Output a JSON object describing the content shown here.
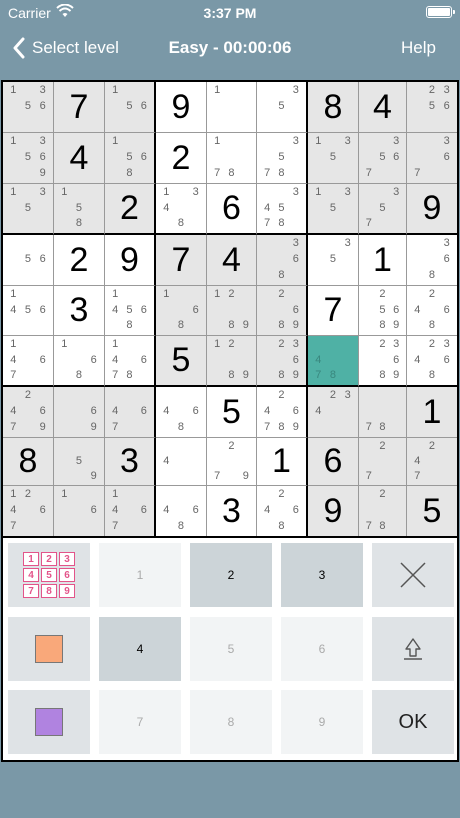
{
  "status": {
    "carrier": "Carrier",
    "time": "3:37 PM"
  },
  "nav": {
    "back": "Select level",
    "title": "Easy - 00:00:06",
    "help": "Help"
  },
  "board": {
    "selected": [
      5,
      6
    ],
    "rows": [
      [
        {
          "n": [
            1,
            3,
            5,
            6
          ]
        },
        {
          "v": "7"
        },
        {
          "n": [
            1,
            5,
            6
          ]
        },
        {
          "v": "9"
        },
        {
          "n": [
            1
          ]
        },
        {
          "n": [
            3,
            5
          ]
        },
        {
          "v": "8"
        },
        {
          "v": "4"
        },
        {
          "n": [
            2,
            3,
            5,
            6
          ]
        }
      ],
      [
        {
          "n": [
            1,
            3,
            5,
            6,
            9
          ]
        },
        {
          "v": "4"
        },
        {
          "n": [
            1,
            5,
            6,
            8
          ]
        },
        {
          "v": "2"
        },
        {
          "n": [
            1,
            7,
            8
          ]
        },
        {
          "n": [
            3,
            5,
            7,
            8
          ]
        },
        {
          "n": [
            1,
            3,
            5
          ]
        },
        {
          "n": [
            3,
            5,
            6,
            7
          ]
        },
        {
          "n": [
            3,
            6,
            7
          ]
        }
      ],
      [
        {
          "n": [
            1,
            3,
            5
          ]
        },
        {
          "n": [
            1,
            5,
            8
          ]
        },
        {
          "v": "2"
        },
        {
          "n": [
            1,
            3,
            4,
            8
          ]
        },
        {
          "v": "6"
        },
        {
          "n": [
            3,
            4,
            5,
            7,
            8
          ]
        },
        {
          "n": [
            1,
            3,
            5
          ]
        },
        {
          "n": [
            3,
            5,
            7
          ]
        },
        {
          "v": "9"
        }
      ],
      [
        {
          "n": [
            5,
            6
          ]
        },
        {
          "v": "2"
        },
        {
          "v": "9"
        },
        {
          "v": "7"
        },
        {
          "v": "4"
        },
        {
          "n": [
            3,
            6,
            8
          ]
        },
        {
          "n": [
            3,
            5
          ]
        },
        {
          "v": "1"
        },
        {
          "n": [
            3,
            6,
            8
          ]
        }
      ],
      [
        {
          "n": [
            1,
            4,
            5,
            6
          ]
        },
        {
          "v": "3"
        },
        {
          "n": [
            1,
            4,
            5,
            6,
            8
          ]
        },
        {
          "n": [
            1,
            6,
            8
          ]
        },
        {
          "n": [
            1,
            2,
            8,
            9
          ]
        },
        {
          "n": [
            2,
            6,
            8,
            9
          ]
        },
        {
          "v": "7"
        },
        {
          "n": [
            2,
            5,
            6,
            8,
            9
          ]
        },
        {
          "n": [
            2,
            4,
            6,
            8
          ]
        }
      ],
      [
        {
          "n": [
            1,
            4,
            6,
            7
          ]
        },
        {
          "n": [
            1,
            6,
            8
          ]
        },
        {
          "n": [
            1,
            4,
            6,
            7,
            8
          ]
        },
        {
          "v": "5"
        },
        {
          "n": [
            1,
            2,
            8,
            9
          ]
        },
        {
          "n": [
            2,
            3,
            6,
            8,
            9
          ]
        },
        {
          "n": [
            4,
            7,
            8
          ]
        },
        {
          "n": [
            2,
            3,
            6,
            8,
            9
          ]
        },
        {
          "n": [
            2,
            3,
            4,
            6,
            8
          ]
        }
      ],
      [
        {
          "n": [
            2,
            4,
            6,
            7,
            9
          ]
        },
        {
          "n": [
            6,
            9
          ]
        },
        {
          "n": [
            4,
            6,
            7
          ]
        },
        {
          "n": [
            4,
            6,
            8
          ]
        },
        {
          "v": "5"
        },
        {
          "n": [
            2,
            4,
            6,
            7,
            8,
            9
          ]
        },
        {
          "n": [
            2,
            3,
            4
          ]
        },
        {
          "n": [
            7,
            8
          ]
        },
        {
          "v": "1"
        }
      ],
      [
        {
          "v": "8"
        },
        {
          "n": [
            5,
            9
          ]
        },
        {
          "v": "3"
        },
        {
          "n": [
            4
          ]
        },
        {
          "n": [
            2,
            7,
            9
          ]
        },
        {
          "v": "1"
        },
        {
          "v": "6"
        },
        {
          "n": [
            2,
            7
          ]
        },
        {
          "n": [
            2,
            4,
            7
          ]
        }
      ],
      [
        {
          "n": [
            1,
            2,
            4,
            6,
            7
          ]
        },
        {
          "n": [
            1,
            6
          ]
        },
        {
          "n": [
            1,
            4,
            6,
            7
          ]
        },
        {
          "n": [
            4,
            6,
            8
          ]
        },
        {
          "v": "3"
        },
        {
          "n": [
            2,
            4,
            6,
            8
          ]
        },
        {
          "v": "9"
        },
        {
          "n": [
            2,
            7,
            8
          ]
        },
        {
          "v": "5"
        }
      ]
    ]
  },
  "keypad": {
    "mini_grid": [
      "1",
      "2",
      "3",
      "4",
      "5",
      "6",
      "7",
      "8",
      "9"
    ],
    "digits": [
      {
        "label": "1",
        "enabled": false
      },
      {
        "label": "2",
        "enabled": true
      },
      {
        "label": "3",
        "enabled": true
      },
      {
        "label": "4",
        "enabled": true
      },
      {
        "label": "5",
        "enabled": false
      },
      {
        "label": "6",
        "enabled": false
      },
      {
        "label": "7",
        "enabled": false
      },
      {
        "label": "8",
        "enabled": false
      },
      {
        "label": "9",
        "enabled": false
      }
    ],
    "ok": "OK",
    "colors": {
      "orange": "#f9a87a",
      "purple": "#b083e0",
      "selected": "#4fb1a5"
    }
  }
}
